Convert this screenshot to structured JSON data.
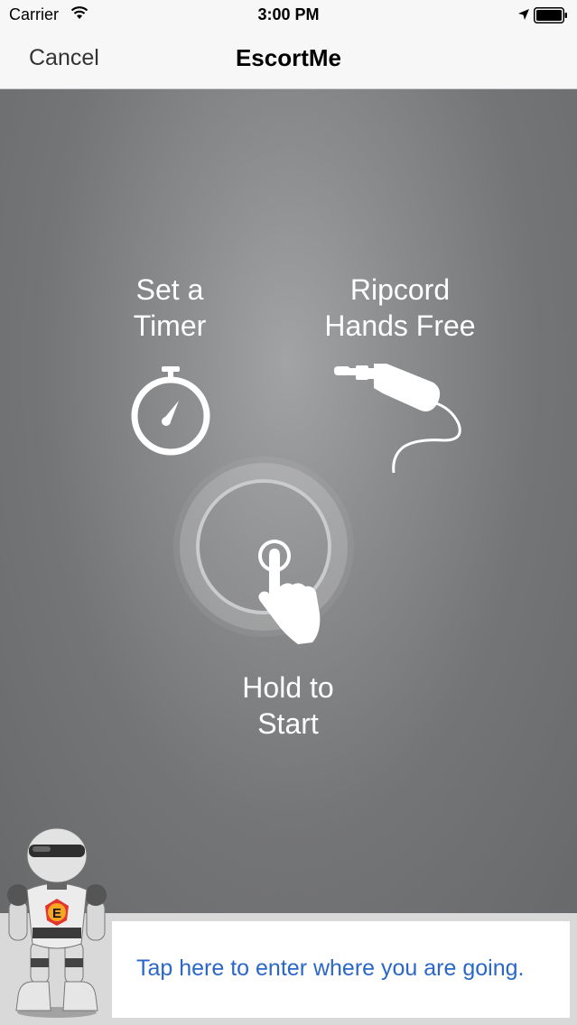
{
  "status_bar": {
    "carrier": "Carrier",
    "time": "3:00 PM",
    "icons": [
      "wifi-icon",
      "location-arrow-icon",
      "battery-icon"
    ]
  },
  "nav": {
    "cancel_label": "Cancel",
    "title": "EscortMe"
  },
  "actions": {
    "timer": {
      "line1": "Set a",
      "line2": "Timer",
      "icon": "stopwatch-icon"
    },
    "ripcord": {
      "line1": "Ripcord",
      "line2": "Hands Free",
      "icon": "headphone-jack-icon"
    },
    "hold": {
      "line1": "Hold to",
      "line2": "Start",
      "icon": "tap-hand-icon"
    }
  },
  "destination": {
    "prompt": "Tap here to enter where you are going."
  },
  "colors": {
    "bar_bg": "#f7f7f7",
    "main_bg": "#6c6d6f",
    "link_blue": "#2a67c9"
  }
}
